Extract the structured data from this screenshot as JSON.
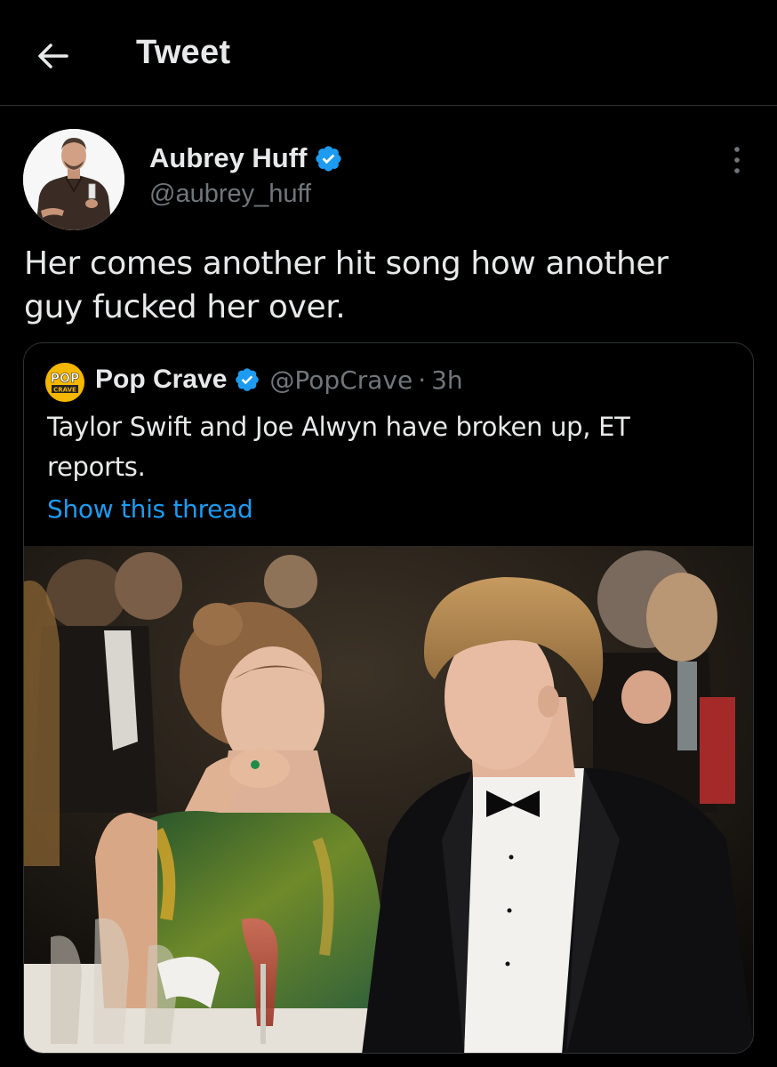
{
  "header": {
    "title": "Tweet",
    "back_icon": "arrow-left-icon"
  },
  "tweet": {
    "author_name": "Aubrey Huff",
    "author_handle": "@aubrey_huff",
    "verified": true,
    "text": "Her comes another hit song how another guy fucked her over.",
    "more_icon": "more-vertical-icon"
  },
  "quote": {
    "logo_text_top": "POP",
    "logo_text_bottom": "CRAVE",
    "author_name": "Pop Crave",
    "author_handle": "@PopCrave",
    "separator": "·",
    "time": "3h",
    "verified": true,
    "text": "Taylor Swift and Joe Alwyn have broken up, ET reports.",
    "show_thread": "Show this thread"
  },
  "colors": {
    "background": "#000000",
    "text": "#e7e9ea",
    "secondary": "#71767b",
    "link": "#1d9bf0",
    "verified": "#1d9bf0",
    "border": "#2f3336"
  }
}
